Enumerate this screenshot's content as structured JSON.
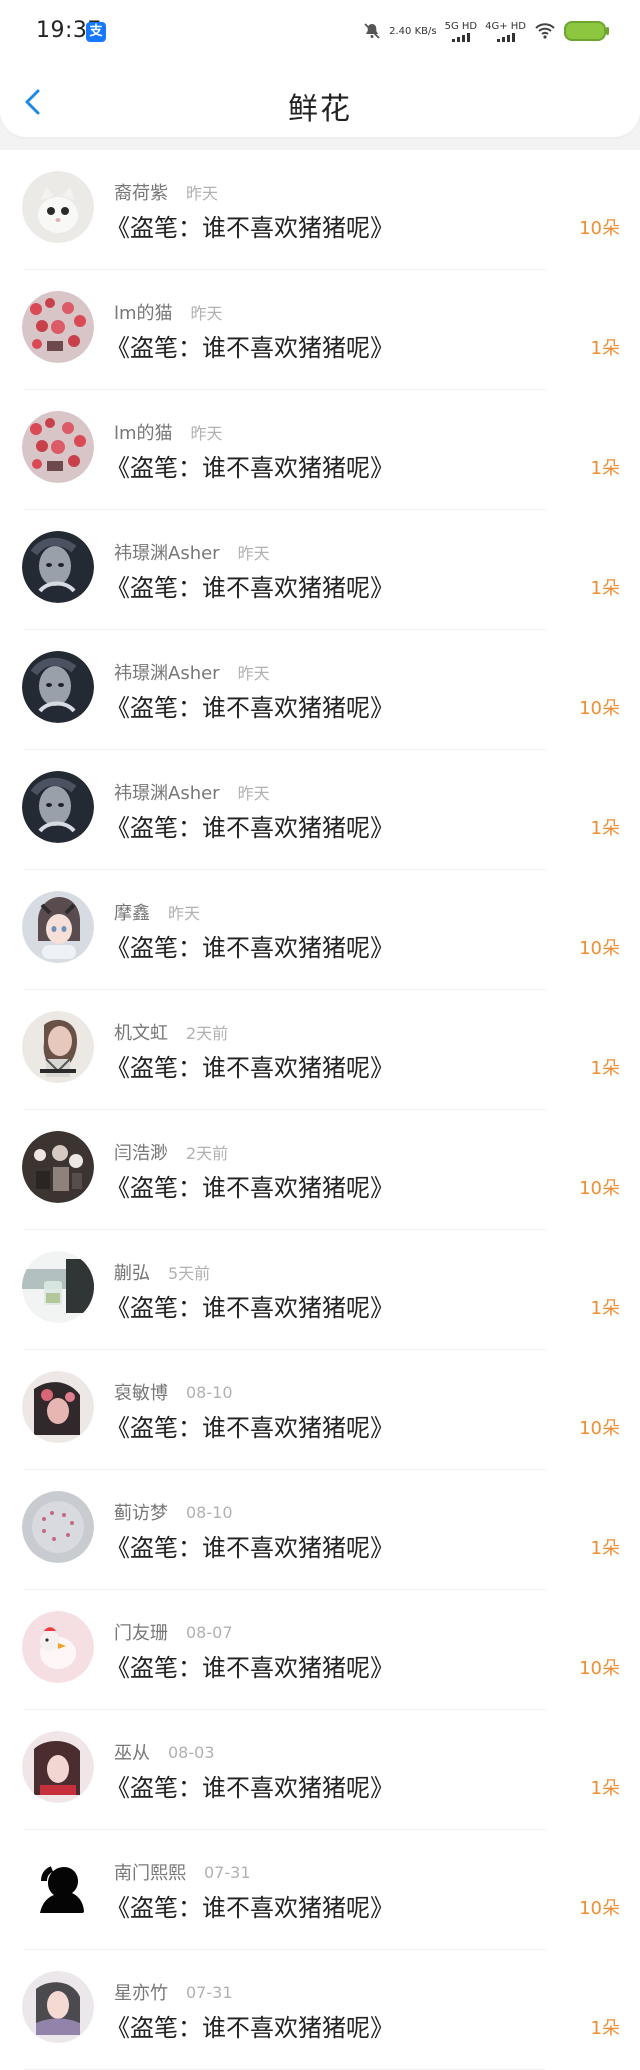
{
  "status_bar": {
    "time": "19:37",
    "pay_icon": "支",
    "network_speed": "2.40 KB/s",
    "network_type_1": "5G HD",
    "network_type_2": "4G+ HD"
  },
  "header": {
    "title": "鲜花"
  },
  "rows": [
    {
      "username": "裔荷紫",
      "time": "昨天",
      "message": "《盗笔：谁不喜欢猪猪呢》",
      "amount": "10朵"
    },
    {
      "username": "lm的猫",
      "time": "昨天",
      "message": "《盗笔：谁不喜欢猪猪呢》",
      "amount": "1朵"
    },
    {
      "username": "lm的猫",
      "time": "昨天",
      "message": "《盗笔：谁不喜欢猪猪呢》",
      "amount": "1朵"
    },
    {
      "username": "祎璟渊Asher",
      "time": "昨天",
      "message": "《盗笔：谁不喜欢猪猪呢》",
      "amount": "1朵"
    },
    {
      "username": "祎璟渊Asher",
      "time": "昨天",
      "message": "《盗笔：谁不喜欢猪猪呢》",
      "amount": "10朵"
    },
    {
      "username": "祎璟渊Asher",
      "time": "昨天",
      "message": "《盗笔：谁不喜欢猪猪呢》",
      "amount": "1朵"
    },
    {
      "username": "摩鑫",
      "time": "昨天",
      "message": "《盗笔：谁不喜欢猪猪呢》",
      "amount": "10朵"
    },
    {
      "username": "机文虹",
      "time": "2天前",
      "message": "《盗笔：谁不喜欢猪猪呢》",
      "amount": "1朵"
    },
    {
      "username": "闫浩渺",
      "time": "2天前",
      "message": "《盗笔：谁不喜欢猪猪呢》",
      "amount": "10朵"
    },
    {
      "username": "蒯弘",
      "time": "5天前",
      "message": "《盗笔：谁不喜欢猪猪呢》",
      "amount": "1朵"
    },
    {
      "username": "裒敏博",
      "time": "08-10",
      "message": "《盗笔：谁不喜欢猪猪呢》",
      "amount": "10朵"
    },
    {
      "username": "蓟访梦",
      "time": "08-10",
      "message": "《盗笔：谁不喜欢猪猪呢》",
      "amount": "1朵"
    },
    {
      "username": "门友珊",
      "time": "08-07",
      "message": "《盗笔：谁不喜欢猪猪呢》",
      "amount": "10朵"
    },
    {
      "username": "巫从",
      "time": "08-03",
      "message": "《盗笔：谁不喜欢猪猪呢》",
      "amount": "1朵"
    },
    {
      "username": "南门熙熙",
      "time": "07-31",
      "message": "《盗笔：谁不喜欢猪猪呢》",
      "amount": "10朵"
    },
    {
      "username": "星亦竹",
      "time": "07-31",
      "message": "《盗笔：谁不喜欢猪猪呢》",
      "amount": "1朵"
    }
  ],
  "colors": {
    "accent": "#1E88E5",
    "amount": "#EE8D32",
    "battery": "#8DC63F"
  }
}
